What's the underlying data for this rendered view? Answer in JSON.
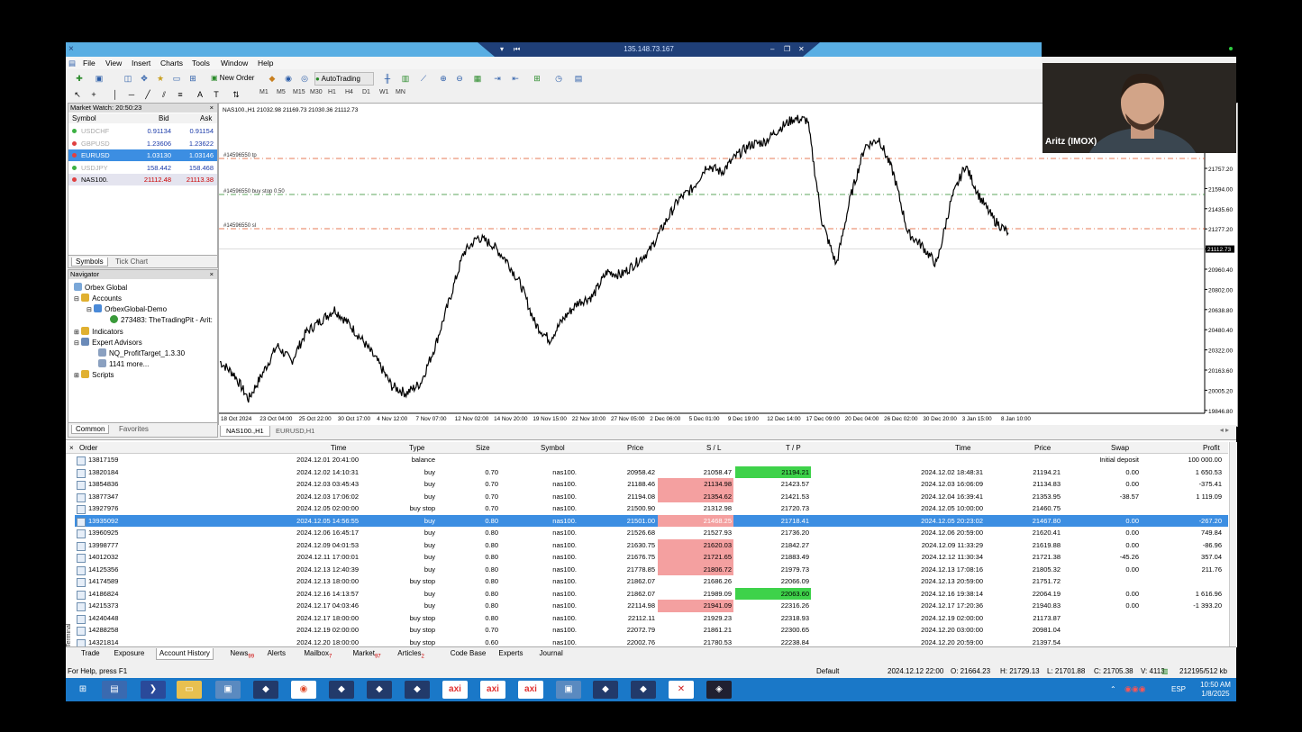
{
  "remote": {
    "host": "135.148.73.167"
  },
  "menu": [
    "File",
    "View",
    "Insert",
    "Charts",
    "Tools",
    "Window",
    "Help"
  ],
  "toolbar": {
    "new_order": "New Order",
    "autotrading": "AutoTrading",
    "timeframes": [
      "M1",
      "M5",
      "M15",
      "M30",
      "H1",
      "H4",
      "D1",
      "W1",
      "MN"
    ]
  },
  "market_watch": {
    "title": "Market Watch: 20:50:23",
    "headers": {
      "symbol": "Symbol",
      "bid": "Bid",
      "ask": "Ask"
    },
    "rows": [
      {
        "symbol": "USDCHF",
        "bid": "0.91134",
        "ask": "0.91154",
        "dot": "#3cb043",
        "style": "dim"
      },
      {
        "symbol": "GBPUSD",
        "bid": "1.23606",
        "ask": "1.23622",
        "dot": "#e04040",
        "style": "dim"
      },
      {
        "symbol": "EURUSD",
        "bid": "1.03130",
        "ask": "1.03146",
        "dot": "#e04040",
        "style": "selected"
      },
      {
        "symbol": "USDJPY",
        "bid": "158.442",
        "ask": "158.468",
        "dot": "#3cb043",
        "style": "dim"
      },
      {
        "symbol": "NAS100.",
        "bid": "21112.48",
        "ask": "21113.38",
        "dot": "#e04040",
        "style": "hl"
      }
    ],
    "tabs": [
      "Symbols",
      "Tick Chart"
    ]
  },
  "navigator": {
    "title": "Navigator",
    "items": [
      "Orbex Global",
      "Accounts",
      "OrbexGlobal-Demo",
      "273483: TheTradingPit - Arit:",
      "Indicators",
      "Expert Advisors",
      "NQ_ProfitTarget_1.3.30",
      "1141 more...",
      "Scripts"
    ],
    "tabs": [
      "Common",
      "Favorites"
    ]
  },
  "chart": {
    "header": "NAS100.,H1  21032.98 21169.73 21030.36 21112.73",
    "lines": [
      {
        "label": "#14596550 tp",
        "color": "#e05020",
        "value": 21680
      },
      {
        "label": "#14596550 buy stop 0.50",
        "color": "#2a8a2a",
        "value": 21500
      },
      {
        "label": "#14596550 sl",
        "color": "#e05020",
        "value": 21290
      }
    ],
    "price_labels": [
      "21757.20",
      "21594.00",
      "21435.60",
      "21277.20",
      "21112.73",
      "20960.40",
      "20802.00",
      "20638.80",
      "20480.40",
      "20322.00",
      "20163.60",
      "20005.20",
      "19846.80"
    ],
    "current_price": "21112.73",
    "time_labels": [
      "18 Oct 2024",
      "23 Oct 04:00",
      "25 Oct 22:00",
      "30 Oct 17:00",
      "4 Nov 12:00",
      "7 Nov 07:00",
      "12 Nov 02:00",
      "14 Nov 20:00",
      "19 Nov 15:00",
      "22 Nov 10:00",
      "27 Nov 05:00",
      "2 Dec 06:00",
      "5 Dec 01:00",
      "9 Dec 19:00",
      "12 Dec 14:00",
      "17 Dec 09:00",
      "20 Dec 04:00",
      "26 Dec 02:00",
      "30 Dec 20:00",
      "3 Jan 15:00",
      "8 Jan 10:00"
    ],
    "tabs": [
      "NAS100.,H1",
      "EURUSD,H1"
    ]
  },
  "chart_data": {
    "type": "line",
    "title": "",
    "xlabel": "",
    "ylabel": "",
    "ylim": [
      19846.8,
      21915.6
    ],
    "series": [
      {
        "name": "",
        "values": [
          20180,
          20090,
          19920,
          20100,
          20290,
          20180,
          20380,
          20460,
          20540,
          20440,
          20320,
          20180,
          20010,
          19960,
          20030,
          20280,
          20600,
          20930,
          21040,
          20990,
          20880,
          20710,
          20440,
          20330,
          20480,
          20590,
          20630,
          20800,
          20780,
          20860,
          20950,
          21130,
          21300,
          21380,
          21540,
          21490,
          21600,
          21680,
          21700,
          21790,
          21860,
          21850,
          21150,
          20850,
          21320,
          21670,
          21720,
          21480,
          21070,
          20980,
          20850,
          21290,
          21540,
          21320,
          21160,
          21070
        ]
      }
    ]
  },
  "terminal": {
    "headers": [
      "Order",
      "Time",
      "Type",
      "Size",
      "Symbol",
      "Price",
      "S / L",
      "T / P",
      "Time",
      "Price",
      "Swap",
      "Profit"
    ],
    "rows": [
      {
        "order": "13817159",
        "time": "2024.12.01 20:41:00",
        "type": "balance",
        "size": "",
        "symbol": "",
        "price": "",
        "sl": "",
        "tp": "",
        "ctime": "",
        "cprice": "",
        "swap": "Initial deposit",
        "profit": "100 000.00",
        "sl_hl": "",
        "tp_hl": "",
        "sel": false
      },
      {
        "order": "13820184",
        "time": "2024.12.02 14:10:31",
        "type": "buy",
        "size": "0.70",
        "symbol": "nas100.",
        "price": "20958.42",
        "sl": "21058.47",
        "tp": "21194.21",
        "ctime": "2024.12.02 18:48:31",
        "cprice": "21194.21",
        "swap": "0.00",
        "profit": "1 650.53",
        "sl_hl": "",
        "tp_hl": "green",
        "sel": false
      },
      {
        "order": "13854836",
        "time": "2024.12.03 03:45:43",
        "type": "buy",
        "size": "0.70",
        "symbol": "nas100.",
        "price": "21188.46",
        "sl": "21134.98",
        "tp": "21423.57",
        "ctime": "2024.12.03 16:06:09",
        "cprice": "21134.83",
        "swap": "0.00",
        "profit": "-375.41",
        "sl_hl": "red",
        "tp_hl": "",
        "sel": false
      },
      {
        "order": "13877347",
        "time": "2024.12.03 17:06:02",
        "type": "buy",
        "size": "0.70",
        "symbol": "nas100.",
        "price": "21194.08",
        "sl": "21354.62",
        "tp": "21421.53",
        "ctime": "2024.12.04 16:39:41",
        "cprice": "21353.95",
        "swap": "-38.57",
        "profit": "1 119.09",
        "sl_hl": "red",
        "tp_hl": "",
        "sel": false
      },
      {
        "order": "13927976",
        "time": "2024.12.05 02:00:00",
        "type": "buy stop",
        "size": "0.70",
        "symbol": "nas100.",
        "price": "21500.90",
        "sl": "21312.98",
        "tp": "21720.73",
        "ctime": "2024.12.05 10:00:00",
        "cprice": "21460.75",
        "swap": "",
        "profit": "",
        "sl_hl": "",
        "tp_hl": "",
        "sel": false
      },
      {
        "order": "13935092",
        "time": "2024.12.05 14:56:55",
        "type": "buy",
        "size": "0.80",
        "symbol": "nas100.",
        "price": "21501.00",
        "sl": "21468.25",
        "tp": "21718.41",
        "ctime": "2024.12.05 20:23:02",
        "cprice": "21467.80",
        "swap": "0.00",
        "profit": "-267.20",
        "sl_hl": "red",
        "tp_hl": "",
        "sel": true
      },
      {
        "order": "13960925",
        "time": "2024.12.06 16:45:17",
        "type": "buy",
        "size": "0.80",
        "symbol": "nas100.",
        "price": "21526.68",
        "sl": "21527.93",
        "tp": "21736.20",
        "ctime": "2024.12.06 20:59:00",
        "cprice": "21620.41",
        "swap": "0.00",
        "profit": "749.84",
        "sl_hl": "",
        "tp_hl": "",
        "sel": false
      },
      {
        "order": "13998777",
        "time": "2024.12.09 04:01:53",
        "type": "buy",
        "size": "0.80",
        "symbol": "nas100.",
        "price": "21630.75",
        "sl": "21620.03",
        "tp": "21842.27",
        "ctime": "2024.12.09 11:33:29",
        "cprice": "21619.88",
        "swap": "0.00",
        "profit": "-86.96",
        "sl_hl": "red",
        "tp_hl": "",
        "sel": false
      },
      {
        "order": "14012032",
        "time": "2024.12.11 17:00:01",
        "type": "buy",
        "size": "0.80",
        "symbol": "nas100.",
        "price": "21676.75",
        "sl": "21721.65",
        "tp": "21883.49",
        "ctime": "2024.12.12 11:30:34",
        "cprice": "21721.38",
        "swap": "-45.26",
        "profit": "357.04",
        "sl_hl": "red",
        "tp_hl": "",
        "sel": false
      },
      {
        "order": "14125356",
        "time": "2024.12.13 12:40:39",
        "type": "buy",
        "size": "0.80",
        "symbol": "nas100.",
        "price": "21778.85",
        "sl": "21806.72",
        "tp": "21979.73",
        "ctime": "2024.12.13 17:08:16",
        "cprice": "21805.32",
        "swap": "0.00",
        "profit": "211.76",
        "sl_hl": "red",
        "tp_hl": "",
        "sel": false
      },
      {
        "order": "14174589",
        "time": "2024.12.13 18:00:00",
        "type": "buy stop",
        "size": "0.80",
        "symbol": "nas100.",
        "price": "21862.07",
        "sl": "21686.26",
        "tp": "22066.09",
        "ctime": "2024.12.13 20:59:00",
        "cprice": "21751.72",
        "swap": "",
        "profit": "",
        "sl_hl": "",
        "tp_hl": "",
        "sel": false
      },
      {
        "order": "14186824",
        "time": "2024.12.16 14:13:57",
        "type": "buy",
        "size": "0.80",
        "symbol": "nas100.",
        "price": "21862.07",
        "sl": "21989.09",
        "tp": "22063.60",
        "ctime": "2024.12.16 19:38:14",
        "cprice": "22064.19",
        "swap": "0.00",
        "profit": "1 616.96",
        "sl_hl": "",
        "tp_hl": "green",
        "sel": false
      },
      {
        "order": "14215373",
        "time": "2024.12.17 04:03:46",
        "type": "buy",
        "size": "0.80",
        "symbol": "nas100.",
        "price": "22114.98",
        "sl": "21941.09",
        "tp": "22316.26",
        "ctime": "2024.12.17 17:20:36",
        "cprice": "21940.83",
        "swap": "0.00",
        "profit": "-1 393.20",
        "sl_hl": "red",
        "tp_hl": "",
        "sel": false
      },
      {
        "order": "14240448",
        "time": "2024.12.17 18:00:00",
        "type": "buy stop",
        "size": "0.80",
        "symbol": "nas100.",
        "price": "22112.11",
        "sl": "21929.23",
        "tp": "22318.93",
        "ctime": "2024.12.19 02:00:00",
        "cprice": "21173.87",
        "swap": "",
        "profit": "",
        "sl_hl": "",
        "tp_hl": "",
        "sel": false
      },
      {
        "order": "14288258",
        "time": "2024.12.19 02:00:00",
        "type": "buy stop",
        "size": "0.70",
        "symbol": "nas100.",
        "price": "22072.79",
        "sl": "21861.21",
        "tp": "22300.65",
        "ctime": "2024.12.20 03:00:00",
        "cprice": "20981.04",
        "swap": "",
        "profit": "",
        "sl_hl": "",
        "tp_hl": "",
        "sel": false
      },
      {
        "order": "14321814",
        "time": "2024.12.20 18:00:00",
        "type": "buy stop",
        "size": "0.60",
        "symbol": "nas100.",
        "price": "22002.76",
        "sl": "21780.53",
        "tp": "22238.84",
        "ctime": "2024.12.20 20:59:00",
        "cprice": "21397.54",
        "swap": "",
        "profit": "",
        "sl_hl": "",
        "tp_hl": "",
        "sel": false
      }
    ],
    "tabs": [
      {
        "label": "Trade",
        "badge": ""
      },
      {
        "label": "Exposure",
        "badge": ""
      },
      {
        "label": "Account History",
        "badge": ""
      },
      {
        "label": "News",
        "badge": "99"
      },
      {
        "label": "Alerts",
        "badge": ""
      },
      {
        "label": "Mailbox",
        "badge": "7"
      },
      {
        "label": "Market",
        "badge": "97"
      },
      {
        "label": "Articles",
        "badge": "2"
      },
      {
        "label": "Code Base",
        "badge": ""
      },
      {
        "label": "Experts",
        "badge": ""
      },
      {
        "label": "Journal",
        "badge": ""
      }
    ],
    "side_label": "Terminal"
  },
  "status": {
    "help": "For Help, press F1",
    "profile": "Default",
    "time": "2024.12.12 22:00",
    "o": "O: 21664.23",
    "h": "H: 21729.13",
    "l": "L: 21701.88",
    "c": "C: 21705.38",
    "v": "V: 4113",
    "traffic": "212195/512 kb"
  },
  "taskbar": {
    "lang": "ESP",
    "clock_time": "10:50 AM",
    "clock_date": "1/8/2025",
    "apps": [
      "win",
      "monitor",
      "powershell",
      "folder",
      "rdp",
      "mt4",
      "chrome",
      "mt4",
      "mt4",
      "mt4",
      "axi",
      "axi",
      "axi",
      "rdp",
      "mt4",
      "mt4",
      "x",
      "cat"
    ]
  },
  "webcam": {
    "name": "Aritz (IMOX)"
  }
}
